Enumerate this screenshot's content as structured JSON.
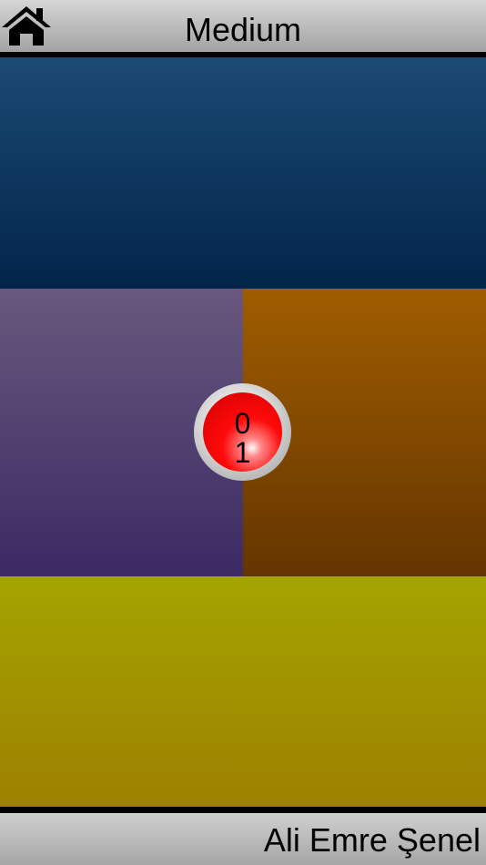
{
  "header": {
    "title": "Medium",
    "home_icon": "home-icon"
  },
  "game": {
    "pads": [
      {
        "color_name": "blue",
        "color_top": "#1b4a74",
        "color_bottom": "#022449"
      },
      {
        "color_name": "purple",
        "color_top": "#68587d",
        "color_bottom": "#3b2a63"
      },
      {
        "color_name": "orange",
        "color_top": "#a05d00",
        "color_bottom": "#643500"
      },
      {
        "color_name": "yellow",
        "color_top": "#a4a400",
        "color_bottom": "#9d8000"
      }
    ],
    "center_button": {
      "top_number": "0",
      "bottom_number": "1",
      "color": "#ff0a0a"
    }
  },
  "footer": {
    "author": "Ali Emre Şenel"
  }
}
